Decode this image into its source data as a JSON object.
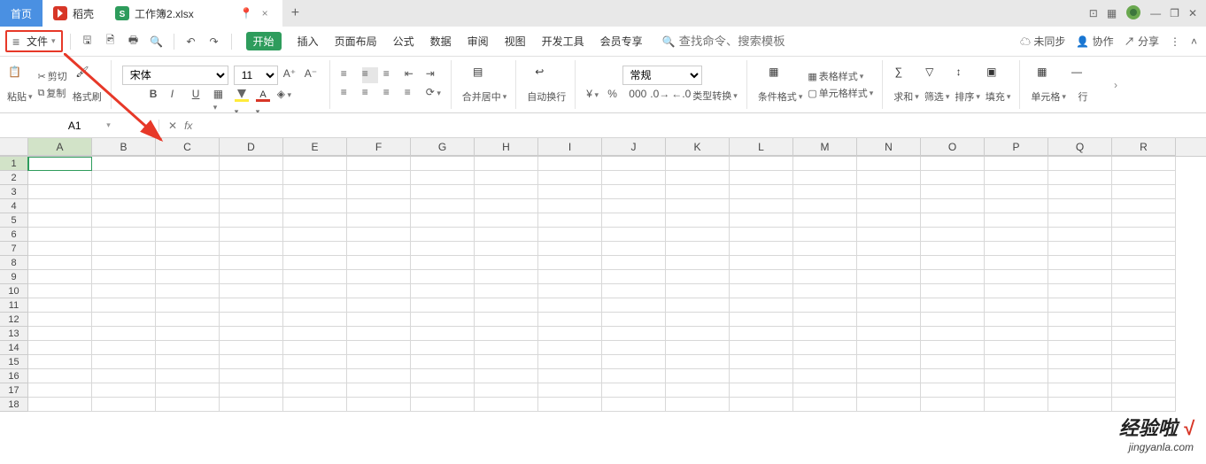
{
  "titlebar": {
    "home_label": "首页",
    "docker_label": "稻壳",
    "doc_label": "工作簿2.xlsx",
    "close_glyph": "×",
    "add_glyph": "+"
  },
  "window": {
    "min": "—",
    "max": "❐",
    "close": "✕"
  },
  "toolbar1": {
    "file_label": "文件",
    "search_placeholder": "查找命令、搜索模板",
    "unsync": "未同步",
    "coop": "协作",
    "share": "分享"
  },
  "menu": {
    "items": [
      "开始",
      "插入",
      "页面布局",
      "公式",
      "数据",
      "审阅",
      "视图",
      "开发工具",
      "会员专享"
    ],
    "active_index": 0
  },
  "ribbon": {
    "paste": "粘贴",
    "cut": "剪切",
    "copy": "复制",
    "fmtpaint": "格式刷",
    "fontname": "宋体",
    "fontsize": "11",
    "merge_center": "合并居中",
    "wrap": "自动换行",
    "numfmt": "常规",
    "typeconv": "类型转换",
    "cond_fmt": "条件格式",
    "table_style": "表格样式",
    "cell_style": "单元格样式",
    "sum": "求和",
    "filter": "筛选",
    "sort": "排序",
    "fill": "填充",
    "cells": "单元格",
    "row": "行"
  },
  "fbar": {
    "namebox": "A1",
    "fx": "fx"
  },
  "grid": {
    "columns": [
      "A",
      "B",
      "C",
      "D",
      "E",
      "F",
      "G",
      "H",
      "I",
      "J",
      "K",
      "L",
      "M",
      "N",
      "O",
      "P",
      "Q",
      "R"
    ],
    "rows": [
      1,
      2,
      3,
      4,
      5,
      6,
      7,
      8,
      9,
      10,
      11,
      12,
      13,
      14,
      15,
      16,
      17,
      18
    ],
    "selected_col": "A",
    "selected_row": 1
  },
  "watermark": {
    "line1a": "经验啦",
    "line1b": "√",
    "line2": "jingyanla.com"
  }
}
